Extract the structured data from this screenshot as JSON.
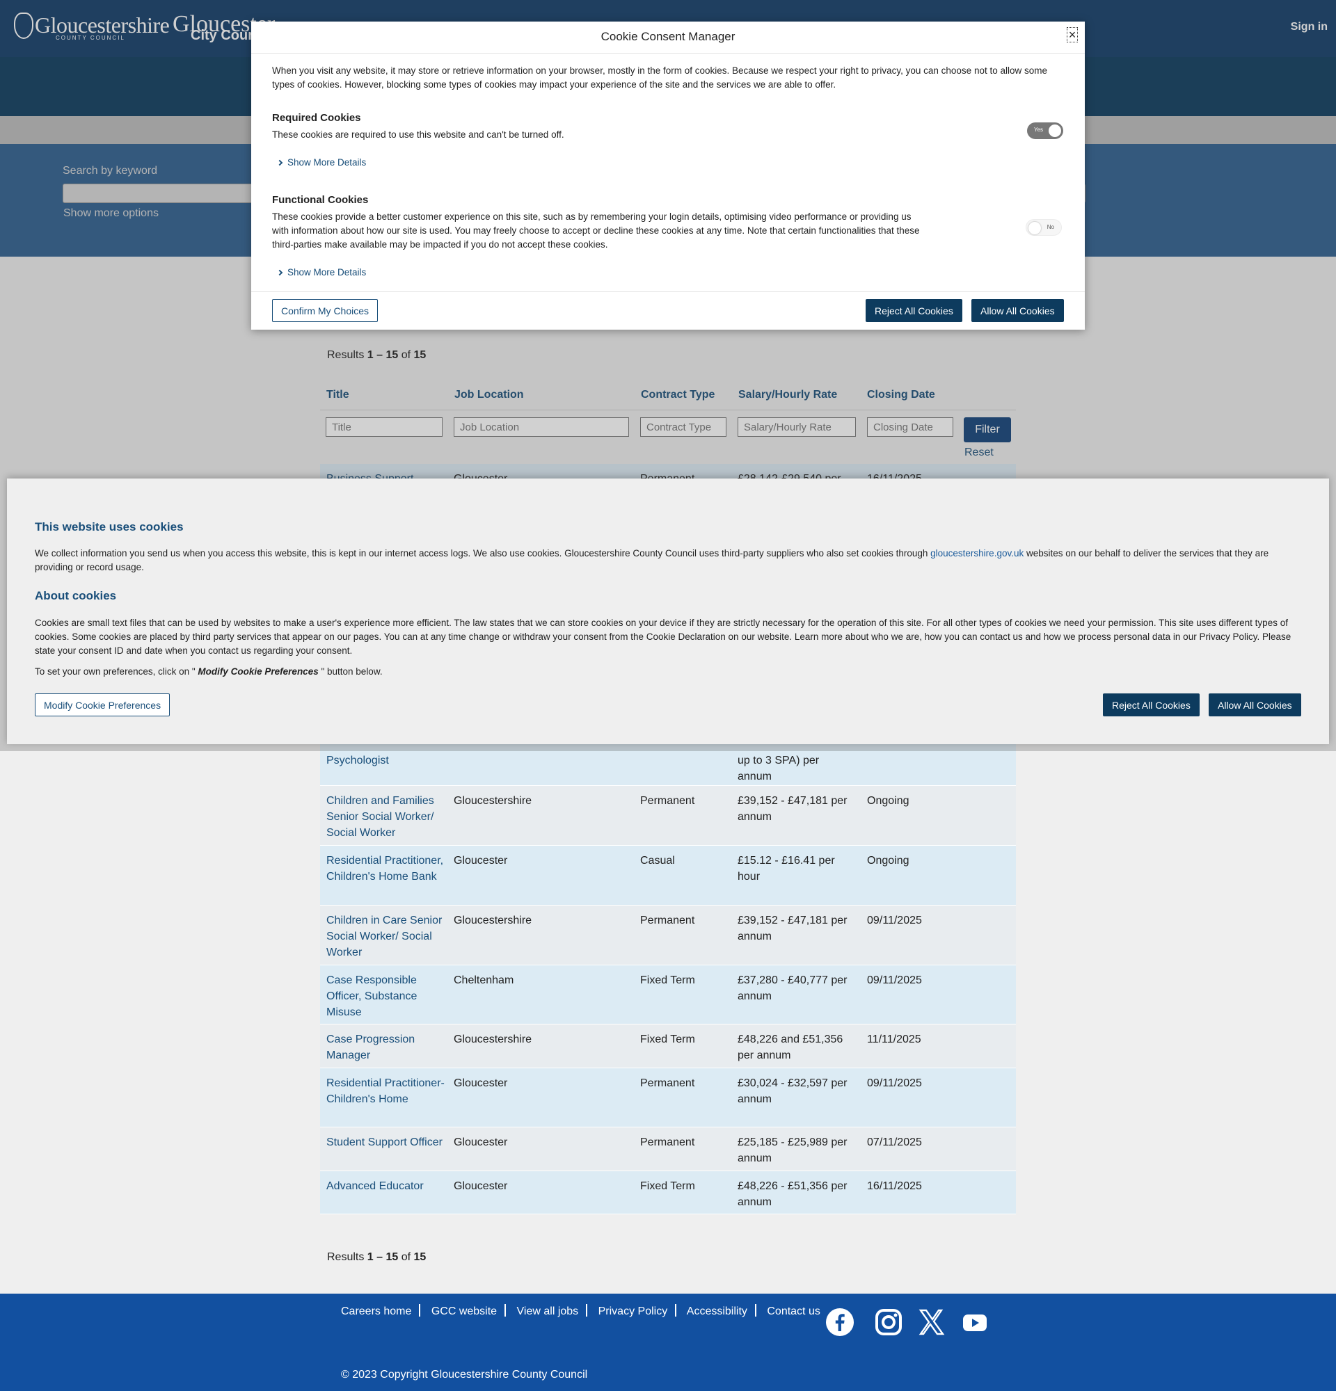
{
  "header": {
    "logo_primary": "Gloucestershire",
    "logo_primary_sub": "COUNTY COUNCIL",
    "logo_secondary": "Gloucester",
    "logo_secondary_sub": "City Council",
    "sign_in": "Sign in"
  },
  "search": {
    "label": "Search by keyword",
    "value": "",
    "show_more": "Show more options"
  },
  "results_top": {
    "prefix": "Results ",
    "range": "1 – 15",
    "of": " of ",
    "total": "15"
  },
  "results_bottom": {
    "prefix": "Results ",
    "range": "1 – 15",
    "of": " of ",
    "total": "15"
  },
  "table": {
    "headers": [
      "Title",
      "Job Location",
      "Contract Type",
      "Salary/Hourly Rate",
      "Closing Date"
    ],
    "filter_placeholders": [
      "Title",
      "Job Location",
      "Contract Type",
      "Salary/Hourly Rate",
      "Closing Date"
    ],
    "filter_button": "Filter",
    "reset": "Reset",
    "rows": [
      {
        "title": "Business Support",
        "location": "Gloucester",
        "contract": "Permanent",
        "salary": "£28,142-£29,540 per",
        "closing": "16/11/2025"
      },
      {
        "title": "Psychologist",
        "location": "",
        "contract": "",
        "salary": "up to 3 SPA) per annum",
        "closing": ""
      },
      {
        "title": "Children and Families Senior Social Worker/ Social Worker",
        "location": "Gloucestershire",
        "contract": "Permanent",
        "salary": "£39,152 - £47,181 per annum",
        "closing": "Ongoing"
      },
      {
        "title": "Residential Practitioner, Children's Home Bank",
        "location": "Gloucester",
        "contract": "Casual",
        "salary": "£15.12 - £16.41 per hour",
        "closing": "Ongoing"
      },
      {
        "title": "Children in Care Senior Social Worker/ Social Worker",
        "location": "Gloucestershire",
        "contract": "Permanent",
        "salary": "£39,152 - £47,181 per annum",
        "closing": "09/11/2025"
      },
      {
        "title": "Case Responsible Officer, Substance Misuse",
        "location": "Cheltenham",
        "contract": "Fixed Term",
        "salary": "£37,280 - £40,777 per annum",
        "closing": "09/11/2025"
      },
      {
        "title": "Case Progression Manager",
        "location": "Gloucestershire",
        "contract": "Fixed Term",
        "salary": "£48,226 and £51,356 per annum",
        "closing": "11/11/2025"
      },
      {
        "title": "Residential Practitioner- Children's Home",
        "location": "Gloucester",
        "contract": "Permanent",
        "salary": "£30,024 - £32,597 per annum",
        "closing": "09/11/2025"
      },
      {
        "title": "Student Support Officer",
        "location": "Gloucester",
        "contract": "Permanent",
        "salary": "£25,185 - £25,989 per annum",
        "closing": "07/11/2025"
      },
      {
        "title": "Advanced Educator",
        "location": "Gloucester",
        "contract": "Fixed Term",
        "salary": "£48,226 - £51,356 per annum",
        "closing": "16/11/2025"
      }
    ]
  },
  "footer": {
    "links": [
      "Careers home",
      "GCC website",
      "View all jobs",
      "Privacy Policy",
      "Accessibility",
      "Contact us"
    ],
    "social_icons": [
      "facebook-icon",
      "instagram-icon",
      "x-icon",
      "youtube-icon"
    ],
    "copyright": "© 2023 Copyright Gloucestershire County Council"
  },
  "banner": {
    "heading1": "This website uses cookies",
    "para1_a": "We collect information you send us when you access this website, this is kept in our internet access logs. We also use cookies. Gloucestershire County Council uses third-party suppliers who also set cookies through ",
    "para1_link": "gloucestershire.gov.uk",
    "para1_b": " websites on our behalf to deliver the services that they are providing or record usage.",
    "heading2": "About cookies",
    "para2": "Cookies are small text files that can be used by websites to make a user's experience more efficient. The law states that we can store cookies on your device if they are strictly necessary for the operation of this site. For all other types of cookies we need your permission. This site uses different types of cookies. Some cookies are placed by third party services that appear on our pages. You can at any time change or withdraw your consent from the Cookie Declaration on our website. Learn more about who we are, how you can contact us and how we process personal data in our Privacy Policy. Please state your consent ID and date when you contact us regarding your consent.",
    "para3_a": "To set your own preferences, click on \" ",
    "para3_em": "Modify Cookie Preferences",
    "para3_b": " \" button below.",
    "modify_button": "Modify Cookie Preferences",
    "reject_button": "Reject All Cookies",
    "allow_button": "Allow All Cookies"
  },
  "modal": {
    "title": "Cookie Consent Manager",
    "close": "×",
    "intro": "When you visit any website, it may store or retrieve information on your browser, mostly in the form of cookies. Because we respect your right to privacy, you can choose not to allow some types of cookies. However, blocking some types of cookies may impact your experience of the site and the services we are able to offer.",
    "required_title": "Required Cookies",
    "required_desc": "These cookies are required to use this website and can't be turned off.",
    "required_toggle": "Yes",
    "functional_title": "Functional Cookies",
    "functional_desc": "These cookies provide a better customer experience on this site, such as by remembering your login details, optimising video performance or providing us with information about how our site is used. You may freely choose to accept or decline these cookies at any time. Note that certain functionalities that these third-parties make available may be impacted if you do not accept these cookies.",
    "functional_toggle": "No",
    "show_more": "Show More Details",
    "confirm_button": "Confirm My Choices",
    "reject_button": "Reject All Cookies",
    "allow_button": "Allow All Cookies"
  }
}
